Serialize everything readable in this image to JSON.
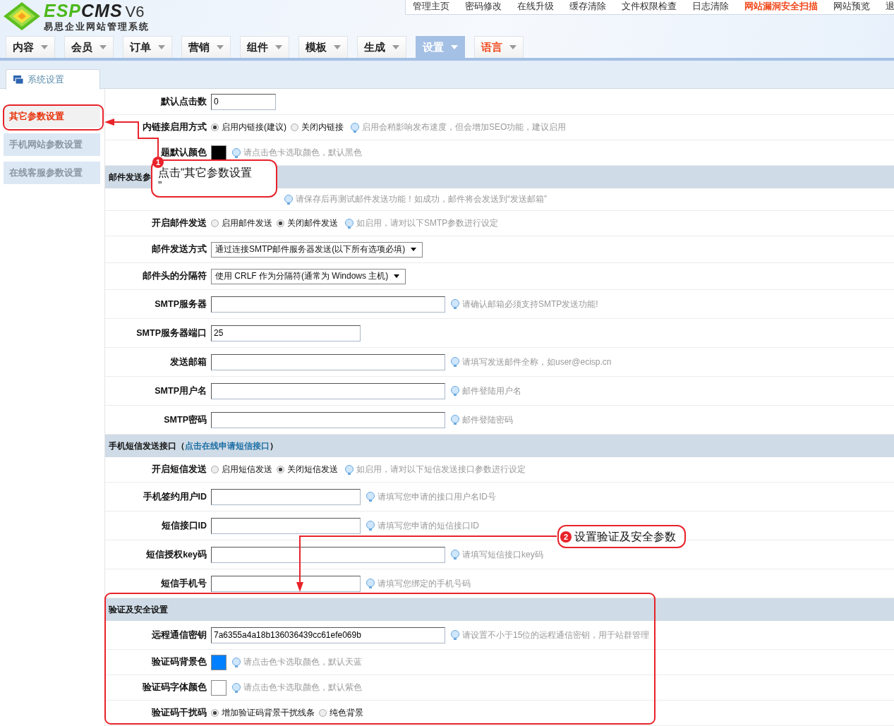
{
  "logo": {
    "brand_a": "ESP",
    "brand_b": "CMS",
    "version": "V6",
    "subtitle": "易思企业网站管理系统"
  },
  "top_links": [
    {
      "label": "管理主页",
      "emphasis": false
    },
    {
      "label": "密码修改",
      "emphasis": false
    },
    {
      "label": "在线升级",
      "emphasis": false
    },
    {
      "label": "缓存清除",
      "emphasis": false
    },
    {
      "label": "文件权限检查",
      "emphasis": false
    },
    {
      "label": "日志清除",
      "emphasis": false
    },
    {
      "label": "网站漏洞安全扫描",
      "emphasis": true
    },
    {
      "label": "网站预览",
      "emphasis": false
    },
    {
      "label": "退",
      "emphasis": false
    }
  ],
  "tabs": [
    {
      "label": "内容",
      "selected": false,
      "emphasis": false
    },
    {
      "label": "会员",
      "selected": false,
      "emphasis": false
    },
    {
      "label": "订单",
      "selected": false,
      "emphasis": false
    },
    {
      "label": "营销",
      "selected": false,
      "emphasis": false
    },
    {
      "label": "组件",
      "selected": false,
      "emphasis": false
    },
    {
      "label": "模板",
      "selected": false,
      "emphasis": false
    },
    {
      "label": "生成",
      "selected": false,
      "emphasis": false
    },
    {
      "label": "设置",
      "selected": true,
      "emphasis": false
    },
    {
      "label": "语言",
      "selected": false,
      "emphasis": true
    }
  ],
  "sidebar": {
    "title": "系统设置",
    "items": [
      {
        "label": "其它参数设置",
        "selected": true
      },
      {
        "label": "手机网站参数设置",
        "selected": false
      },
      {
        "label": "在线客服参数设置",
        "selected": false
      }
    ]
  },
  "sections": [
    {
      "rows": [
        {
          "label": "默认点击数",
          "kind": "short",
          "value": "0"
        },
        {
          "label": "内链接启用方式",
          "kind": "radio",
          "options": [
            {
              "label": "启用内链接(建议)",
              "selected": true
            },
            {
              "label": "关闭内链接",
              "selected": false
            }
          ],
          "hint": "启用会稍影响发布速度，但会增加SEO功能，建议启用"
        },
        {
          "label": "题默认颜色",
          "kind": "color",
          "color": "#000000",
          "hint": "请点击色卡选取颜色，默认黑色"
        }
      ]
    },
    {
      "title": "邮件发送参",
      "rows": [
        {
          "label": "",
          "kind": "note",
          "hint": "请保存后再测试邮件发送功能！如成功，邮件将会发送到“发送邮箱”"
        },
        {
          "label": "开启邮件发送",
          "kind": "radio",
          "options": [
            {
              "label": "启用邮件发送",
              "selected": false
            },
            {
              "label": "关闭邮件发送",
              "selected": true
            }
          ],
          "hint": "如启用，请对以下SMTP参数进行设定"
        },
        {
          "label": "邮件发送方式",
          "kind": "select",
          "value": "通过连接SMTP邮件服务器发送(以下所有选项必填)"
        },
        {
          "label": "邮件头的分隔符",
          "kind": "select",
          "value": "使用 CRLF 作为分隔符(通常为 Windows 主机)"
        },
        {
          "label": "SMTP服务器",
          "kind": "long",
          "value": "",
          "hint": "请确认邮箱必须支持SMTP发送功能!"
        },
        {
          "label": "SMTP服务器端口",
          "kind": "medium",
          "value": "25"
        },
        {
          "label": "发送邮箱",
          "kind": "long",
          "value": "",
          "hint": "请填写发送邮件全称，如user@ecisp.cn"
        },
        {
          "label": "SMTP用户名",
          "kind": "long",
          "value": "",
          "hint": "邮件登陆用户名"
        },
        {
          "label": "SMTP密码",
          "kind": "long",
          "value": "",
          "hint": "邮件登陆密码"
        }
      ]
    },
    {
      "title": "手机短信发送接口（",
      "link": "点击在线申请短信接口",
      "title_end": "）",
      "rows": [
        {
          "label": "开启短信发送",
          "kind": "radio",
          "options": [
            {
              "label": "启用短信发送",
              "selected": false
            },
            {
              "label": "关闭短信发送",
              "selected": true
            }
          ],
          "hint": "如启用，请对以下短信发送接口参数进行设定"
        },
        {
          "label": "手机签约用户ID",
          "kind": "medium",
          "value": "",
          "hint": "请填写您申请的接口用户名ID号"
        },
        {
          "label": "短信接口ID",
          "kind": "medium",
          "value": "",
          "hint": "请填写您申请的短信接口ID"
        },
        {
          "label": "短信授权key码",
          "kind": "long",
          "value": "",
          "hint": "请填写短信接口key码"
        },
        {
          "label": "短信手机号",
          "kind": "medium",
          "value": "",
          "hint": "请填写您绑定的手机号码"
        }
      ]
    },
    {
      "title": "验证及安全设置",
      "rows": [
        {
          "label": "远程通信密钥",
          "kind": "long",
          "value": "7a6355a4a18b136036439cc61efe069b",
          "hint": "请设置不小于15位的远程通信密钥，用于站群管理"
        },
        {
          "label": "验证码背景色",
          "kind": "color",
          "color": "#0080ff",
          "hint": "请点击色卡选取颜色，默认天蓝"
        },
        {
          "label": "验证码字体颜色",
          "kind": "color",
          "color": "#ffffff",
          "hint": "请点击色卡选取颜色，默认紫色"
        },
        {
          "label": "验证码干扰码",
          "kind": "radio",
          "options": [
            {
              "label": "增加验证码背景干扰线条",
              "selected": true
            },
            {
              "label": "纯色背景",
              "selected": false
            }
          ]
        }
      ]
    }
  ],
  "callouts": [
    {
      "number": "1",
      "text": "点击“其它参数设置\n”"
    },
    {
      "number": "2",
      "text": "设置验证及安全参数"
    }
  ]
}
